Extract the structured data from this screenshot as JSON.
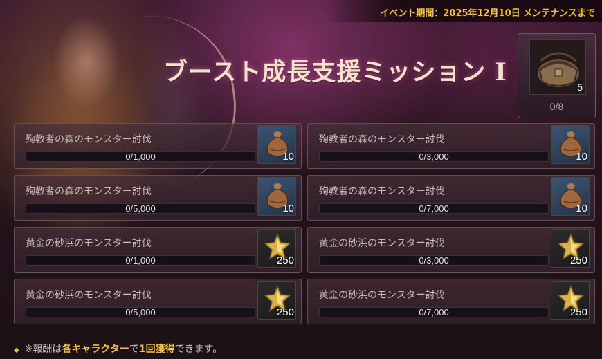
{
  "event_period": "イベント期間：2025年12月10日 メンテナンスまで",
  "title": "ブースト成長支援ミッション I",
  "grand_reward": {
    "icon": "leather-bag-icon",
    "quantity": "5",
    "progress": "0/8"
  },
  "missions": [
    {
      "label": "殉教者の森のモンスター討伐",
      "progress": "0/1,000",
      "progress_fraction": 0,
      "reward_icon": "pouch-icon",
      "reward_qty": "10"
    },
    {
      "label": "殉教者の森のモンスター討伐",
      "progress": "0/3,000",
      "progress_fraction": 0,
      "reward_icon": "pouch-icon",
      "reward_qty": "10"
    },
    {
      "label": "殉教者の森のモンスター討伐",
      "progress": "0/5,000",
      "progress_fraction": 0,
      "reward_icon": "pouch-icon",
      "reward_qty": "10"
    },
    {
      "label": "殉教者の森のモンスター討伐",
      "progress": "0/7,000",
      "progress_fraction": 0,
      "reward_icon": "pouch-icon",
      "reward_qty": "10"
    },
    {
      "label": "黄金の砂浜のモンスター討伐",
      "progress": "0/1,000",
      "progress_fraction": 0,
      "reward_icon": "gold-star-icon",
      "reward_qty": "250"
    },
    {
      "label": "黄金の砂浜のモンスター討伐",
      "progress": "0/3,000",
      "progress_fraction": 0,
      "reward_icon": "gold-star-icon",
      "reward_qty": "250"
    },
    {
      "label": "黄金の砂浜のモンスター討伐",
      "progress": "0/5,000",
      "progress_fraction": 0,
      "reward_icon": "gold-star-icon",
      "reward_qty": "250"
    },
    {
      "label": "黄金の砂浜のモンスター討伐",
      "progress": "0/7,000",
      "progress_fraction": 0,
      "reward_icon": "gold-star-icon",
      "reward_qty": "250"
    }
  ],
  "footer": {
    "bullet": "◆",
    "prefix": "※報酬は",
    "highlight1": "各キャラクター",
    "middle": "で",
    "highlight2": "1回獲得",
    "suffix": "できます。"
  },
  "colors": {
    "accent": "#f2c23a",
    "progress_fill": "#c49a5a"
  }
}
